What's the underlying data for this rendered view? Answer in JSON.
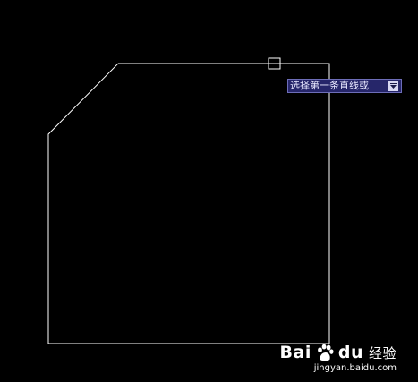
{
  "prompt": {
    "text": "选择第一条直线或",
    "arrow_icon": "dropdown-arrow-icon"
  },
  "watermark": {
    "text_left": "Bai",
    "text_right": "du",
    "product": "经验",
    "url": "jingyan.baidu.com"
  },
  "colors": {
    "background": "#000000",
    "line": "#ffffff",
    "prompt_bg": "#26266a",
    "prompt_border": "#6d6db8"
  }
}
